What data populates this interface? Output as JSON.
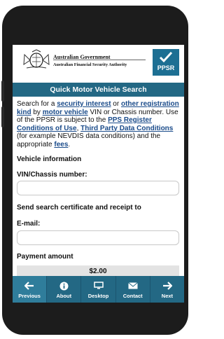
{
  "header": {
    "gov_line1": "Australian Government",
    "gov_line2": "Australian Financial Security Authority",
    "logo_text": "PPSR"
  },
  "title": "Quick Motor Vehicle Search",
  "intro": {
    "t1": "Search for a ",
    "link1": "security interest",
    "t2": " or ",
    "link2": "other registration kind",
    "t3": " by ",
    "link3": "motor vehicle",
    "t4": " VIN or Chassis number. Use of the PPSR is subject to the ",
    "link4": "PPS Register Conditions of Use",
    "t5": ", ",
    "link5": "Third Party Data Conditions",
    "t6": " (for example NEVDIS data conditions) and the appropriate ",
    "link6": "fees",
    "t7": "."
  },
  "form": {
    "vehicle_heading": "Vehicle information",
    "vin_label": "VIN/Chassis number:",
    "vin_value": "",
    "send_heading": "Send search certificate and receipt to",
    "email_label": "E-mail:",
    "email_value": "",
    "payment_heading": "Payment amount",
    "amount": "$2.00"
  },
  "toolbar": [
    {
      "label": "Previous",
      "icon": "arrow-left-icon",
      "active": true
    },
    {
      "label": "About",
      "icon": "info-icon",
      "active": false
    },
    {
      "label": "Desktop",
      "icon": "monitor-icon",
      "active": false
    },
    {
      "label": "Contact",
      "icon": "envelope-icon",
      "active": false
    },
    {
      "label": "Next",
      "icon": "arrow-right-icon",
      "active": false
    }
  ],
  "colors": {
    "brand_blue": "#236884",
    "link_blue": "#1a4b8a",
    "phone_frame": "#1c1c1c"
  }
}
